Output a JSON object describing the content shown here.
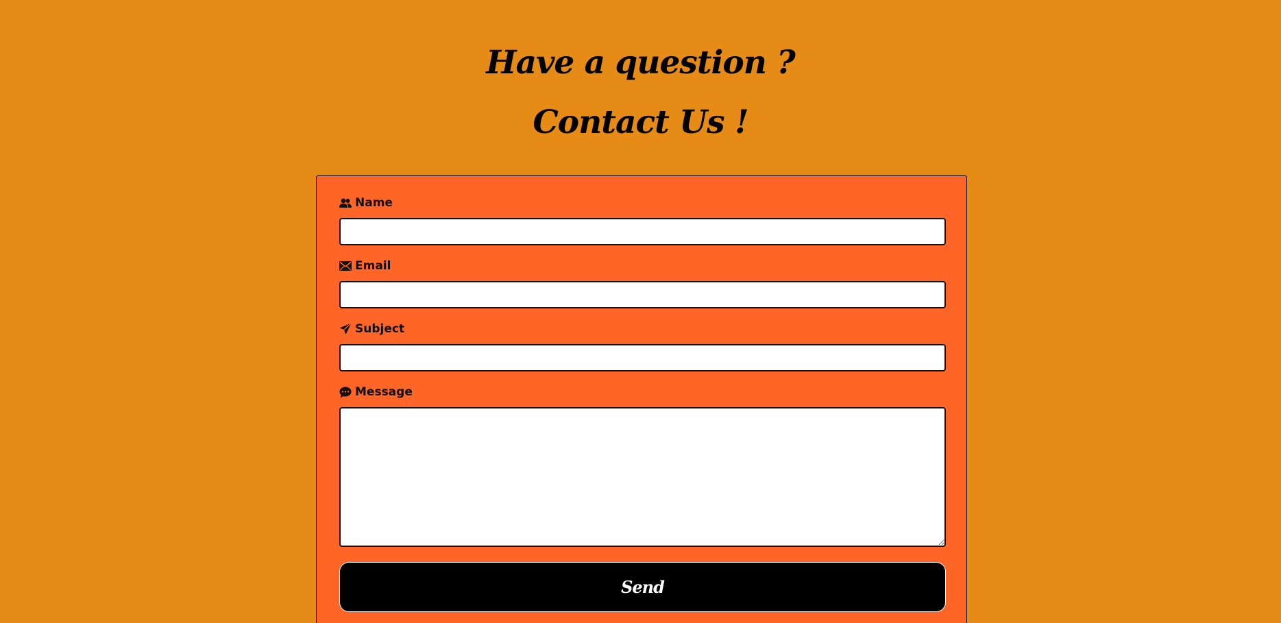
{
  "header": {
    "line1": "Have a question ?",
    "line2": "Contact Us !"
  },
  "form": {
    "name": {
      "label": "Name",
      "icon": "users-icon",
      "value": ""
    },
    "email": {
      "label": "Email",
      "icon": "envelope-icon",
      "value": ""
    },
    "subject": {
      "label": "Subject",
      "icon": "paper-plane-icon",
      "value": ""
    },
    "message": {
      "label": "Message",
      "icon": "comment-icon",
      "value": ""
    },
    "send_label": "Send"
  },
  "colors": {
    "page_background": "#e68c16",
    "card_background": "#ff6526",
    "button_background": "#000000",
    "button_text": "#ffffff"
  }
}
